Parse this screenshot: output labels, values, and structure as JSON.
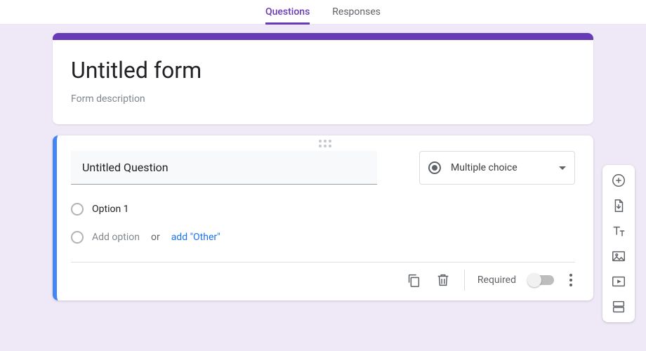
{
  "tabs": {
    "questions": "Questions",
    "responses": "Responses"
  },
  "header": {
    "title": "Untitled form",
    "description": "Form description"
  },
  "question": {
    "title": "Untitled Question",
    "type_label": "Multiple choice",
    "options": [
      {
        "label": "Option 1"
      }
    ],
    "add_option": "Add option",
    "or": "or",
    "add_other": "add \"Other\""
  },
  "footer": {
    "required_label": "Required"
  }
}
